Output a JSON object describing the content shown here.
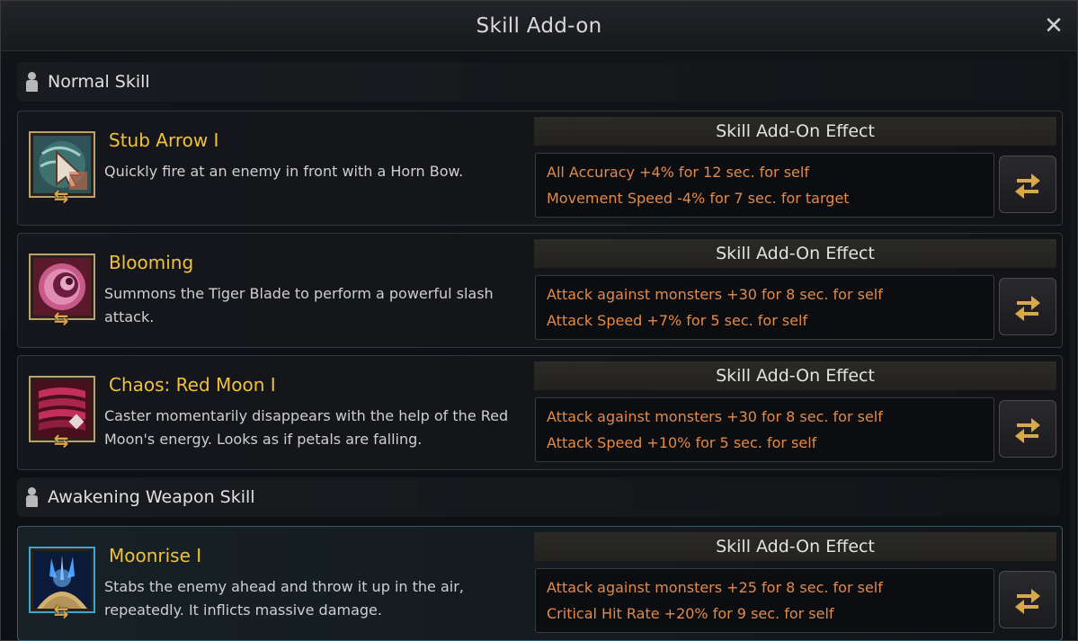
{
  "window": {
    "title": "Skill Add-on",
    "close_label": "✕"
  },
  "sections": {
    "normal": {
      "title": "Normal Skill"
    },
    "awakening": {
      "title": "Awakening Weapon Skill"
    }
  },
  "effect_header_label": "Skill Add-On Effect",
  "skills": [
    {
      "name": "Stub Arrow I",
      "description": "Quickly fire at an enemy in front with a Horn Bow.",
      "icon": "bow-arrow-icon",
      "effects": [
        "All Accuracy +4% for 12 sec. for self",
        "Movement Speed -4% for 7 sec. for target"
      ]
    },
    {
      "name": "Blooming",
      "description": "Summons the Tiger Blade to perform a powerful slash attack.",
      "icon": "crescent-swirl-icon",
      "effects": [
        "Attack against monsters +30 for 8 sec. for self",
        "Attack Speed +7% for 5 sec. for self"
      ]
    },
    {
      "name": "Chaos: Red Moon I",
      "description": "Caster momentarily disappears with the help of the Red Moon's energy. Looks as if petals are falling.",
      "icon": "red-moon-icon",
      "effects": [
        "Attack against monsters +30 for 8 sec. for self",
        "Attack Speed +10% for 5 sec. for self"
      ]
    },
    {
      "name": "Moonrise I",
      "description": "Stabs the enemy ahead and throw it up in the air, repeatedly. It inflicts massive damage.",
      "icon": "moonrise-icon",
      "effects": [
        "Attack against monsters +25 for 8 sec. for self",
        "Critical Hit Rate +20% for 9 sec. for self"
      ]
    }
  ],
  "colors": {
    "skill_name": "#f1c232",
    "effect_text": "#e28a4a",
    "icon_border": "#b9a170",
    "selected_border": "#3aa7d8"
  }
}
